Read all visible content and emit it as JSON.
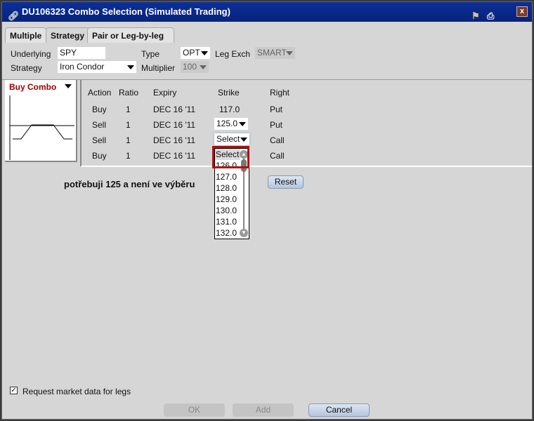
{
  "window": {
    "title": "DU106323 Combo Selection (Simulated Trading)"
  },
  "tabs": [
    {
      "label": "Multiple"
    },
    {
      "label": "Strategy"
    },
    {
      "label": "Pair or Leg-by-leg"
    }
  ],
  "form": {
    "underlying_label": "Underlying",
    "underlying_value": "SPY",
    "type_label": "Type",
    "type_value": "OPT",
    "legexch_label": "Leg Exch",
    "legexch_value": "SMART",
    "strategy_label": "Strategy",
    "strategy_value": "Iron Condor",
    "multiplier_label": "Multiplier",
    "multiplier_value": "100"
  },
  "combo": {
    "label": "Buy Combo",
    "color": "#a00000"
  },
  "table": {
    "headers": [
      "Action",
      "Ratio",
      "Expiry",
      "Strike",
      "Right"
    ],
    "rows": [
      [
        "Buy",
        "1",
        "DEC 16 '11",
        "117.0",
        "Put"
      ],
      [
        "Sell",
        "1",
        "DEC 16 '11",
        "125.0",
        "Put"
      ],
      [
        "Sell",
        "1",
        "DEC 16 '11",
        "Select",
        "Call"
      ],
      [
        "Buy",
        "1",
        "DEC 16 '11",
        "",
        "Call"
      ]
    ]
  },
  "dropdown": {
    "options": [
      "Select",
      "126.0",
      "127.0",
      "128.0",
      "129.0",
      "130.0",
      "131.0",
      "132.0"
    ]
  },
  "annotation": "potřebuji 125 a není ve výběru",
  "reset_label": "Reset",
  "checkbox": {
    "label": "Request market data for legs",
    "checked": true
  },
  "buttons": {
    "ok": "OK",
    "add": "Add",
    "cancel": "Cancel"
  }
}
